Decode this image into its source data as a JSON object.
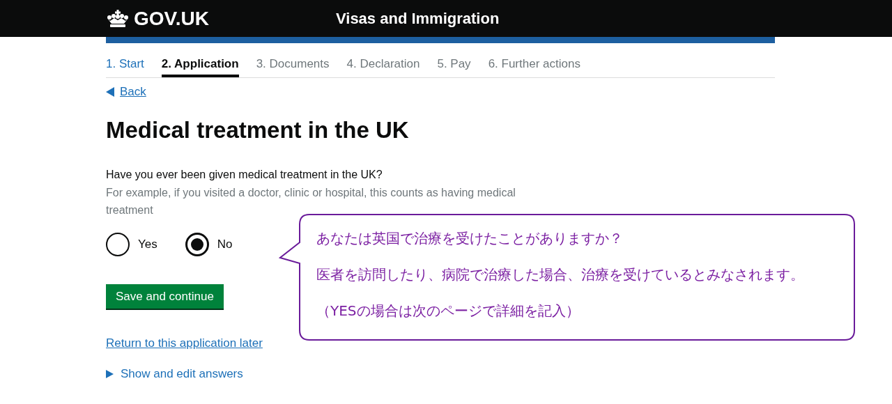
{
  "header": {
    "logo": "GOV.UK",
    "service": "Visas and Immigration"
  },
  "steps": [
    {
      "label": "1. Start",
      "selected": false,
      "completed": true
    },
    {
      "label": "2. Application",
      "selected": true,
      "completed": false
    },
    {
      "label": "3. Documents",
      "selected": false,
      "completed": false
    },
    {
      "label": "4. Declaration",
      "selected": false,
      "completed": false
    },
    {
      "label": "5. Pay",
      "selected": false,
      "completed": false
    },
    {
      "label": "6. Further actions",
      "selected": false,
      "completed": false
    }
  ],
  "back_link": "Back",
  "title": "Medical treatment in the UK",
  "question": "Have you ever been given medical treatment in the UK?",
  "hint": "For example, if you visited a doctor, clinic or hospital, this counts as having medical treatment",
  "options": [
    {
      "label": "Yes",
      "selected": false
    },
    {
      "label": "No",
      "selected": true
    }
  ],
  "save_button": "Save and continue",
  "return_link": "Return to this application later",
  "details": "Show and edit answers",
  "callout": [
    "あなたは英国で治療を受けたことがありますか？",
    "医者を訪問したり、病院で治療した場合、治療を受けているとみなされます。",
    "（YESの場合は次のページで詳細を記入）"
  ]
}
